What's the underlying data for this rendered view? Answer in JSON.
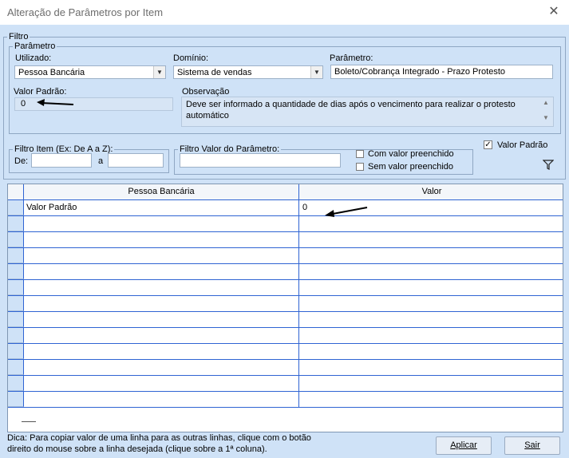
{
  "window": {
    "title": "Alteração de Parâmetros por Item",
    "close_icon": "close-icon"
  },
  "filtro": {
    "legend": "Filtro",
    "parametro": {
      "legend": "Parâmetro",
      "utilizado_label": "Utilizado:",
      "utilizado_value": "Pessoa Bancária",
      "dominio_label": "Domínio:",
      "dominio_value": "Sistema de vendas",
      "parametro_label": "Parâmetro:",
      "parametro_value": "Boleto/Cobrança Integrado - Prazo Protesto",
      "valor_padrao_label": "Valor Padrão:",
      "valor_padrao_value": "0",
      "observacao_label": "Observação",
      "observacao_text": "Deve ser informado a quantidade de dias após o vencimento para realizar o protesto automático"
    },
    "filtro_item": {
      "legend": "Filtro Item (Ex: De A a Z):",
      "de_label": "De:",
      "a_label": "a",
      "de_value": "",
      "a_value": ""
    },
    "filtro_valor": {
      "legend": "Filtro Valor do Parâmetro:",
      "value": "",
      "com_valor": "Com valor preenchido",
      "sem_valor": "Sem valor preenchido"
    },
    "valor_padrao_check": {
      "label": "Valor Padrão",
      "checked": true
    },
    "filter_icon": "funnel-icon"
  },
  "grid": {
    "columns": [
      "Pessoa Bancária",
      "Valor"
    ],
    "rows": [
      {
        "item": "Valor Padrão",
        "valor": "0"
      }
    ]
  },
  "footer": {
    "hint_line1": "Dica: Para copiar valor de uma linha para as outras linhas, clique com o botão",
    "hint_line2": "direito do mouse sobre a linha desejada (clique sobre a 1ª coluna).",
    "aplicar": "Aplicar",
    "sair": "Sair"
  }
}
